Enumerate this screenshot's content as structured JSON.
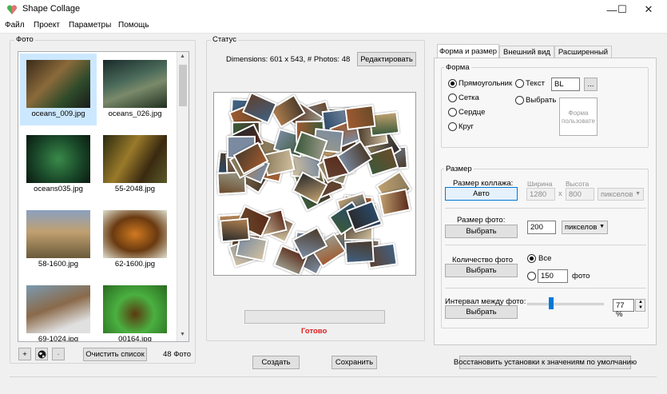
{
  "window": {
    "title": "Shape Collage",
    "min": "—",
    "max": "☐",
    "close": "✕"
  },
  "menu": [
    "Файл",
    "Проект",
    "Параметры",
    "Помощь"
  ],
  "photos_panel": {
    "label": "Фото",
    "items": [
      "oceans_009.jpg",
      "oceans_026.jpg",
      "oceans035.jpg",
      "55-2048.jpg",
      "58-1600.jpg",
      "62-1600.jpg",
      "69-1024.jpg",
      "00164.jpg"
    ],
    "add_btn": "+",
    "remove_btn": "-",
    "clear_btn": "Очистить список",
    "count": "48 Фото"
  },
  "status_panel": {
    "label": "Статус",
    "dimensions": "Dimensions: 601 x 543, # Photos: 48",
    "edit_btn": "Редактировать",
    "status_text": "Готово",
    "status_color": "#e02020"
  },
  "bottom": {
    "create_btn": "Создать",
    "save_btn": "Сохранить",
    "restore_btn": "Восстановить установки к значениям по умолчанию"
  },
  "tabs": [
    "Форма и размер",
    "Внешний вид",
    "Расширенный"
  ],
  "shape": {
    "label": "Форма",
    "rect": "Прямоугольник",
    "grid": "Сетка",
    "heart": "Сердце",
    "circle": "Круг",
    "text": "Текст",
    "text_value": "BL",
    "browse_btn": "...",
    "choose": "Выбрать",
    "preview": "Форма пользовате"
  },
  "size": {
    "label": "Размер",
    "collage_size_label": "Размер коллажа:",
    "auto_btn": "Авто",
    "width_label": "Ширина",
    "height_label": "Высота",
    "width_value": "1280",
    "x_sep": "x",
    "height_value": "800",
    "units_disabled": "пикселов",
    "photo_size_label": "Размер фото:",
    "photo_size_btn": "Выбрать",
    "photo_size_value": "200",
    "units": "пикселов",
    "photo_count_label": "Количество фото",
    "photo_count_btn": "Выбрать",
    "all_label": "Все",
    "count_value": "150",
    "count_unit": "фото",
    "spacing_label": "Интервал между фото:",
    "spacing_btn": "Выбрать",
    "spacing_value": "77 %",
    "spacing_level": 0.3
  }
}
